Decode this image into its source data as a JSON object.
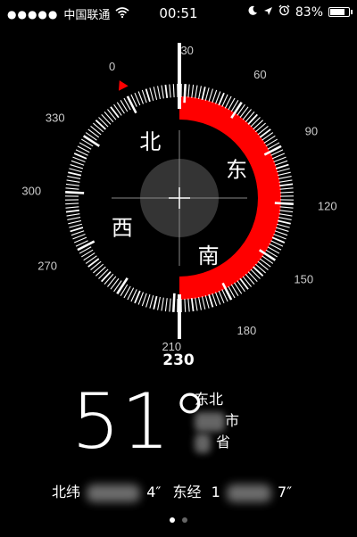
{
  "status_bar": {
    "signal_dots": "●●●●●",
    "carrier": "中国联通",
    "wifi_icon": "wifi-icon",
    "time": "00:51",
    "battery_percent": "83%",
    "battery_level": 0.83
  },
  "compass": {
    "heading_readout": "230",
    "cardinals": {
      "north": "北",
      "east": "东",
      "south": "南",
      "west": "西"
    },
    "degree_labels": [
      "0",
      "30",
      "60",
      "90",
      "120",
      "150",
      "180",
      "210",
      "270",
      "300",
      "330"
    ],
    "accent_color": "#ff0000"
  },
  "reading": {
    "degrees": "51°",
    "direction": "东北",
    "city_suffix": "市",
    "province_suffix": "省"
  },
  "coordinates": {
    "lat_label": "北纬",
    "lat_tail": "4″",
    "lon_label": "东经",
    "lon_partial": "1",
    "lon_tail": "7″"
  },
  "pager": {
    "pages": 2,
    "current": 0
  }
}
